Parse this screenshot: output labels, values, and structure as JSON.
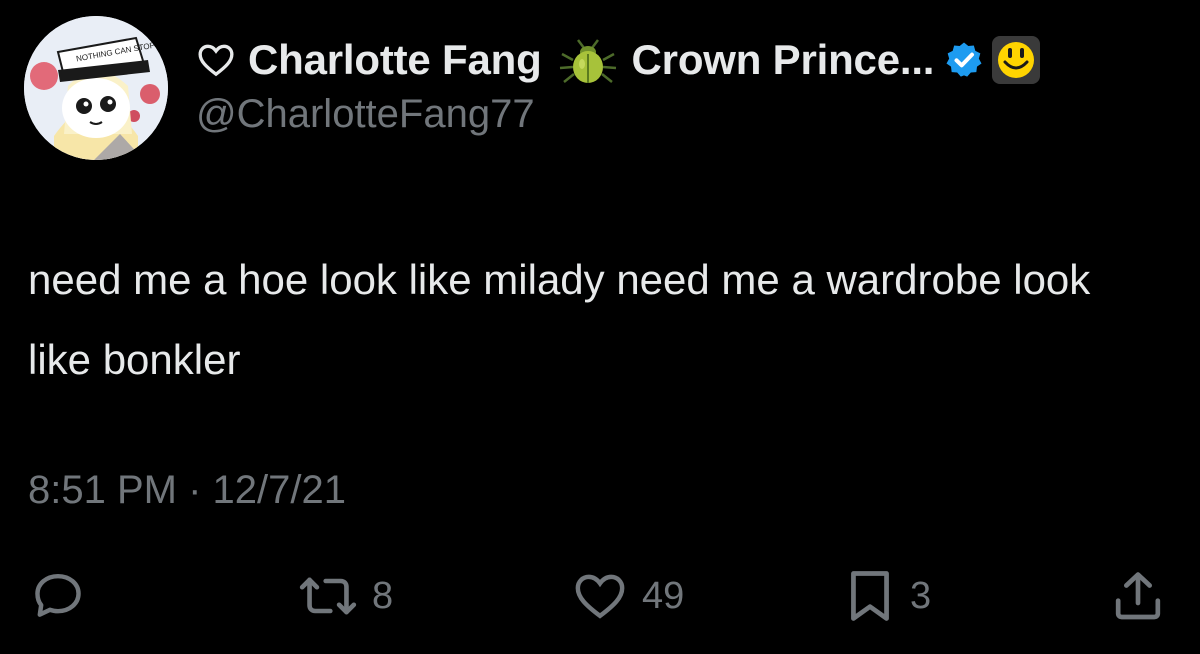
{
  "author": {
    "display_name": "Charlotte Fang",
    "name_suffix": "Crown Prince...",
    "handle": "@CharlotteFang77",
    "avatar_hat_text": "NOTHING CAN STOP THIS",
    "icons": {
      "name_prefix": "heart-outline-icon",
      "emoji": "beetle-emoji-icon",
      "verified": "verified-badge-icon",
      "affiliate": "smiley-affiliate-icon"
    }
  },
  "tweet": {
    "text": "need me a hoe look like milady need me a wardrobe look like bonkler",
    "time": "8:51 PM",
    "separator": "·",
    "date": "12/7/21"
  },
  "actions": {
    "reply": {
      "icon": "reply-icon",
      "count": ""
    },
    "retweet": {
      "icon": "retweet-icon",
      "count": "8"
    },
    "like": {
      "icon": "heart-icon",
      "count": "49"
    },
    "bookmark": {
      "icon": "bookmark-icon",
      "count": "3"
    },
    "share": {
      "icon": "share-icon",
      "count": ""
    }
  },
  "colors": {
    "background": "#000000",
    "primary_text": "#e7e9ea",
    "secondary_text": "#71767b",
    "verified_blue": "#1d9bf0",
    "affiliate_yellow": "#ffd400"
  }
}
